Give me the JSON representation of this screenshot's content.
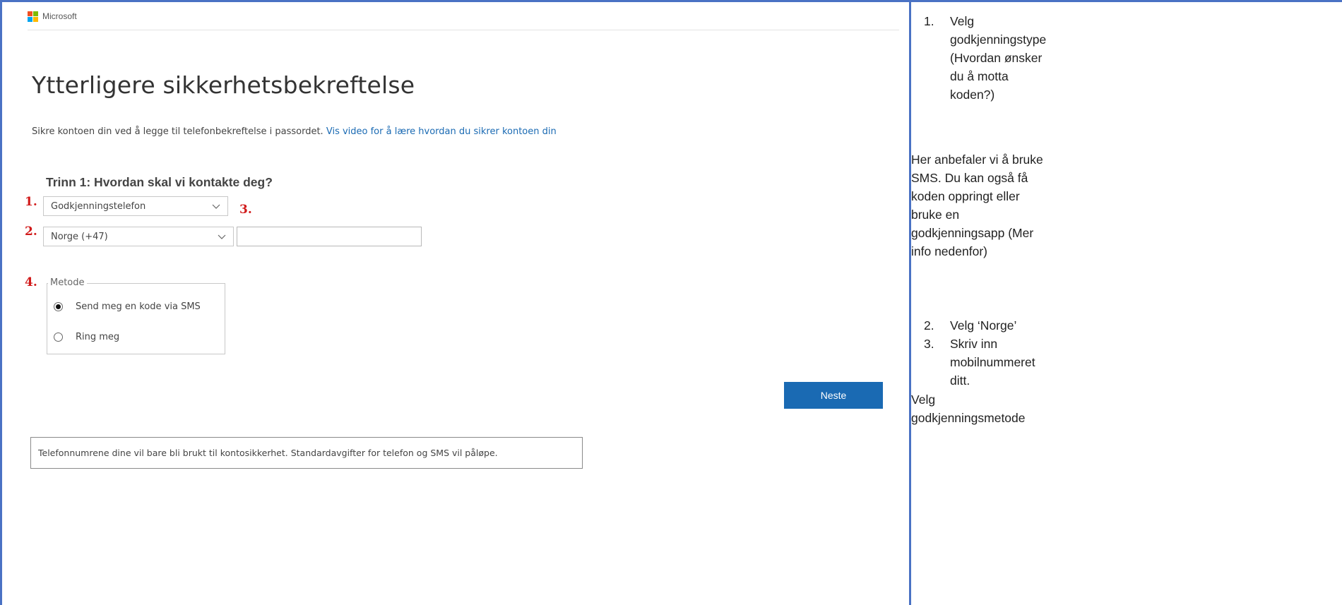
{
  "brand": {
    "name": "Microsoft",
    "logo_colors": [
      "#f25022",
      "#7fba00",
      "#00a4ef",
      "#ffb900"
    ]
  },
  "page": {
    "title": "Ytterligere sikkerhetsbekreftelse",
    "intro_text": "Sikre kontoen din ved å legge til telefonbekreftelse i passordet.",
    "intro_link": "Vis video for å lære hvordan du sikrer kontoen din",
    "step_heading": "Trinn 1: Hvordan skal vi kontakte deg?"
  },
  "markers": {
    "one": "1.",
    "two": "2.",
    "three": "3.",
    "four": "4."
  },
  "form": {
    "auth_type_value": "Godkjenningstelefon",
    "country_value": "Norge (+47)",
    "phone_value": "",
    "method_legend": "Metode",
    "methods": [
      {
        "label": "Send meg en kode via SMS",
        "checked": true
      },
      {
        "label": "Ring meg",
        "checked": false
      }
    ],
    "next_label": "Neste",
    "notice_text": "Telefonnumrene dine vil bare bli brukt til kontosikkerhet. Standardavgifter for telefon og SMS vil påløpe."
  },
  "instructions": {
    "item1": "Velg godkjenningstype (Hvordan ønsker du å motta koden?)",
    "item1_lines": [
      "Velg",
      "godkjenningstype",
      "(Hvordan ønsker",
      "du å motta",
      "koden?)"
    ],
    "item1_number": "1.",
    "paragraph_lines": [
      "Her anbefaler vi å bruke",
      "SMS. Du kan også få",
      "koden oppringt eller",
      "bruke en",
      "godkjenningsapp (Mer",
      "info nedenfor)"
    ],
    "item2_number": "2.",
    "item2": "Velg ‘Norge’",
    "item3_number": "3.",
    "item3_lines": [
      "Skriv inn",
      "mobilnummeret",
      "ditt."
    ],
    "final_lines": [
      "Velg",
      "godkjenningsmetode"
    ]
  },
  "colors": {
    "frame_border": "#4a72c4",
    "accent_blue": "#1a6ab3",
    "marker_red": "#d11a1a"
  }
}
